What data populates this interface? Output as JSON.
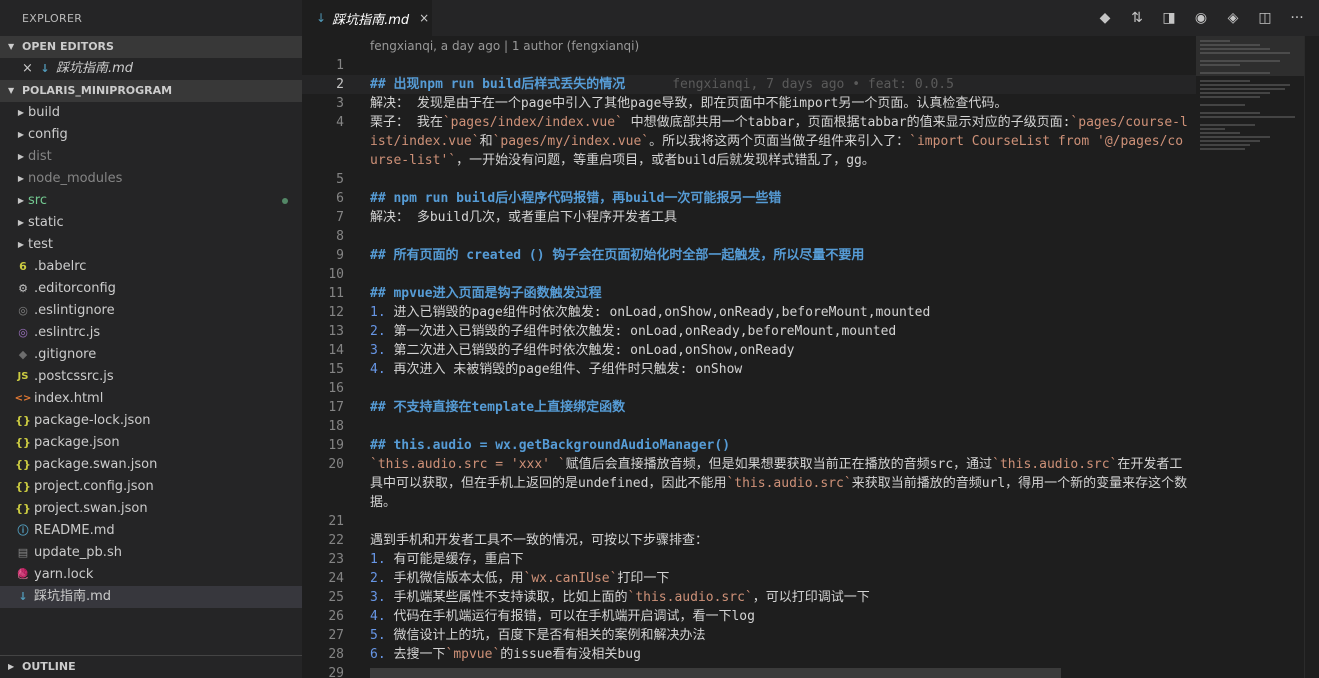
{
  "sidebar": {
    "title": "EXPLORER",
    "open_editors": {
      "header": "OPEN EDITORS",
      "items": [
        {
          "name": "踩坑指南.md"
        }
      ]
    },
    "project": {
      "header": "POLARIS_MINIPROGRAM",
      "items": [
        {
          "label": "build",
          "type": "folder"
        },
        {
          "label": "config",
          "type": "folder"
        },
        {
          "label": "dist",
          "type": "folder"
        },
        {
          "label": "node_modules",
          "type": "folder"
        },
        {
          "label": "src",
          "type": "folder"
        },
        {
          "label": "static",
          "type": "folder"
        },
        {
          "label": "test",
          "type": "folder"
        },
        {
          "label": ".babelrc",
          "icon": "6"
        },
        {
          "label": ".editorconfig",
          "icon": "⚙"
        },
        {
          "label": ".eslintignore",
          "icon": "◎"
        },
        {
          "label": ".eslintrc.js",
          "icon": "◎"
        },
        {
          "label": ".gitignore",
          "icon": "◆"
        },
        {
          "label": ".postcssrc.js",
          "icon": "JS"
        },
        {
          "label": "index.html",
          "icon": "<>"
        },
        {
          "label": "package-lock.json",
          "icon": "{}"
        },
        {
          "label": "package.json",
          "icon": "{}"
        },
        {
          "label": "package.swan.json",
          "icon": "{}"
        },
        {
          "label": "project.config.json",
          "icon": "{}"
        },
        {
          "label": "project.swan.json",
          "icon": "{}"
        },
        {
          "label": "README.md",
          "icon": "ⓘ"
        },
        {
          "label": "update_pb.sh",
          "icon": "▤"
        },
        {
          "label": "yarn.lock",
          "icon": "🧶"
        },
        {
          "label": "踩坑指南.md",
          "icon": "↓"
        }
      ]
    },
    "outline": {
      "header": "OUTLINE"
    }
  },
  "tab": {
    "title": "踩坑指南.md",
    "close": "×"
  },
  "toolbar_icons": [
    "git-compare-icon",
    "git-pull-request-icon",
    "open-preview-icon",
    "toggle-eye-icon",
    "git-commit-icon",
    "split-editor-icon",
    "more-actions-icon"
  ],
  "editor": {
    "codelens": "fengxianqi, a day ago | 1 author (fengxianqi)",
    "blame": "fengxianqi, 7 days ago • feat: 0.0.5",
    "lines": [
      {
        "n": "1",
        "t": ""
      },
      {
        "n": "2",
        "t": "## 出现npm run build后样式丢失的情况"
      },
      {
        "n": "3",
        "t": "解决： 发现是由于在一个page中引入了其他page导致，即在页面中不能import另一个页面。认真检查代码。"
      },
      {
        "n": "4",
        "t": "栗子： 我在`pages/index/index.vue` 中想做底部共用一个tabbar，页面根据tabbar的值来显示对应的子级页面:`pages/course-list/index.vue`和`pages/my/index.vue`。所以我将这两个页面当做子组件来引入了：`import CourseList from '@/pages/course-list'`，一开始没有问题，等重启项目，或者build后就发现样式错乱了，gg。"
      },
      {
        "n": "5",
        "t": ""
      },
      {
        "n": "6",
        "t": "## npm run build后小程序代码报错，再build一次可能报另一些错"
      },
      {
        "n": "7",
        "t": "解决： 多build几次，或者重启下小程序开发者工具"
      },
      {
        "n": "8",
        "t": ""
      },
      {
        "n": "9",
        "t": "## 所有页面的 created () 钩子会在页面初始化时全部一起触发，所以尽量不要用"
      },
      {
        "n": "10",
        "t": ""
      },
      {
        "n": "11",
        "t": "## mpvue进入页面是钩子函数触发过程"
      },
      {
        "n": "12",
        "t": "1. 进入已销毁的page组件时依次触发: onLoad,onShow,onReady,beforeMount,mounted"
      },
      {
        "n": "13",
        "t": "2. 第一次进入已销毁的子组件时依次触发: onLoad,onReady,beforeMount,mounted"
      },
      {
        "n": "14",
        "t": "3. 第二次进入已销毁的子组件时依次触发: onLoad,onShow,onReady"
      },
      {
        "n": "15",
        "t": "4. 再次进入 未被销毁的page组件、子组件时只触发: onShow"
      },
      {
        "n": "16",
        "t": ""
      },
      {
        "n": "17",
        "t": "## 不支持直接在template上直接绑定函数"
      },
      {
        "n": "18",
        "t": ""
      },
      {
        "n": "19",
        "t": "## this.audio = wx.getBackgroundAudioManager()"
      },
      {
        "n": "20",
        "t": "`this.audio.src = 'xxx' `赋值后会直接播放音频，但是如果想要获取当前正在播放的音频src，通过`this.audio.src`在开发者工具中可以获取，但在手机上返回的是undefined，因此不能用`this.audio.src`来获取当前播放的音频url，得用一个新的变量来存这个数据。"
      },
      {
        "n": "21",
        "t": ""
      },
      {
        "n": "22",
        "t": "遇到手机和开发者工具不一致的情况，可按以下步骤排查："
      },
      {
        "n": "23",
        "t": "1. 有可能是缓存，重启下"
      },
      {
        "n": "24",
        "t": "2. 手机微信版本太低，用`wx.canIUse`打印一下"
      },
      {
        "n": "25",
        "t": "3. 手机端某些属性不支持读取，比如上面的`this.audio.src`，可以打印调试一下"
      },
      {
        "n": "26",
        "t": "4. 代码在手机端运行有报错，可以在手机端开启调试，看一下log"
      },
      {
        "n": "27",
        "t": "5. 微信设计上的坑，百度下是否有相关的案例和解决办法"
      },
      {
        "n": "28",
        "t": "6. 去搜一下`mpvue`的issue看有没相关bug"
      },
      {
        "n": "29",
        "t": ""
      }
    ]
  }
}
